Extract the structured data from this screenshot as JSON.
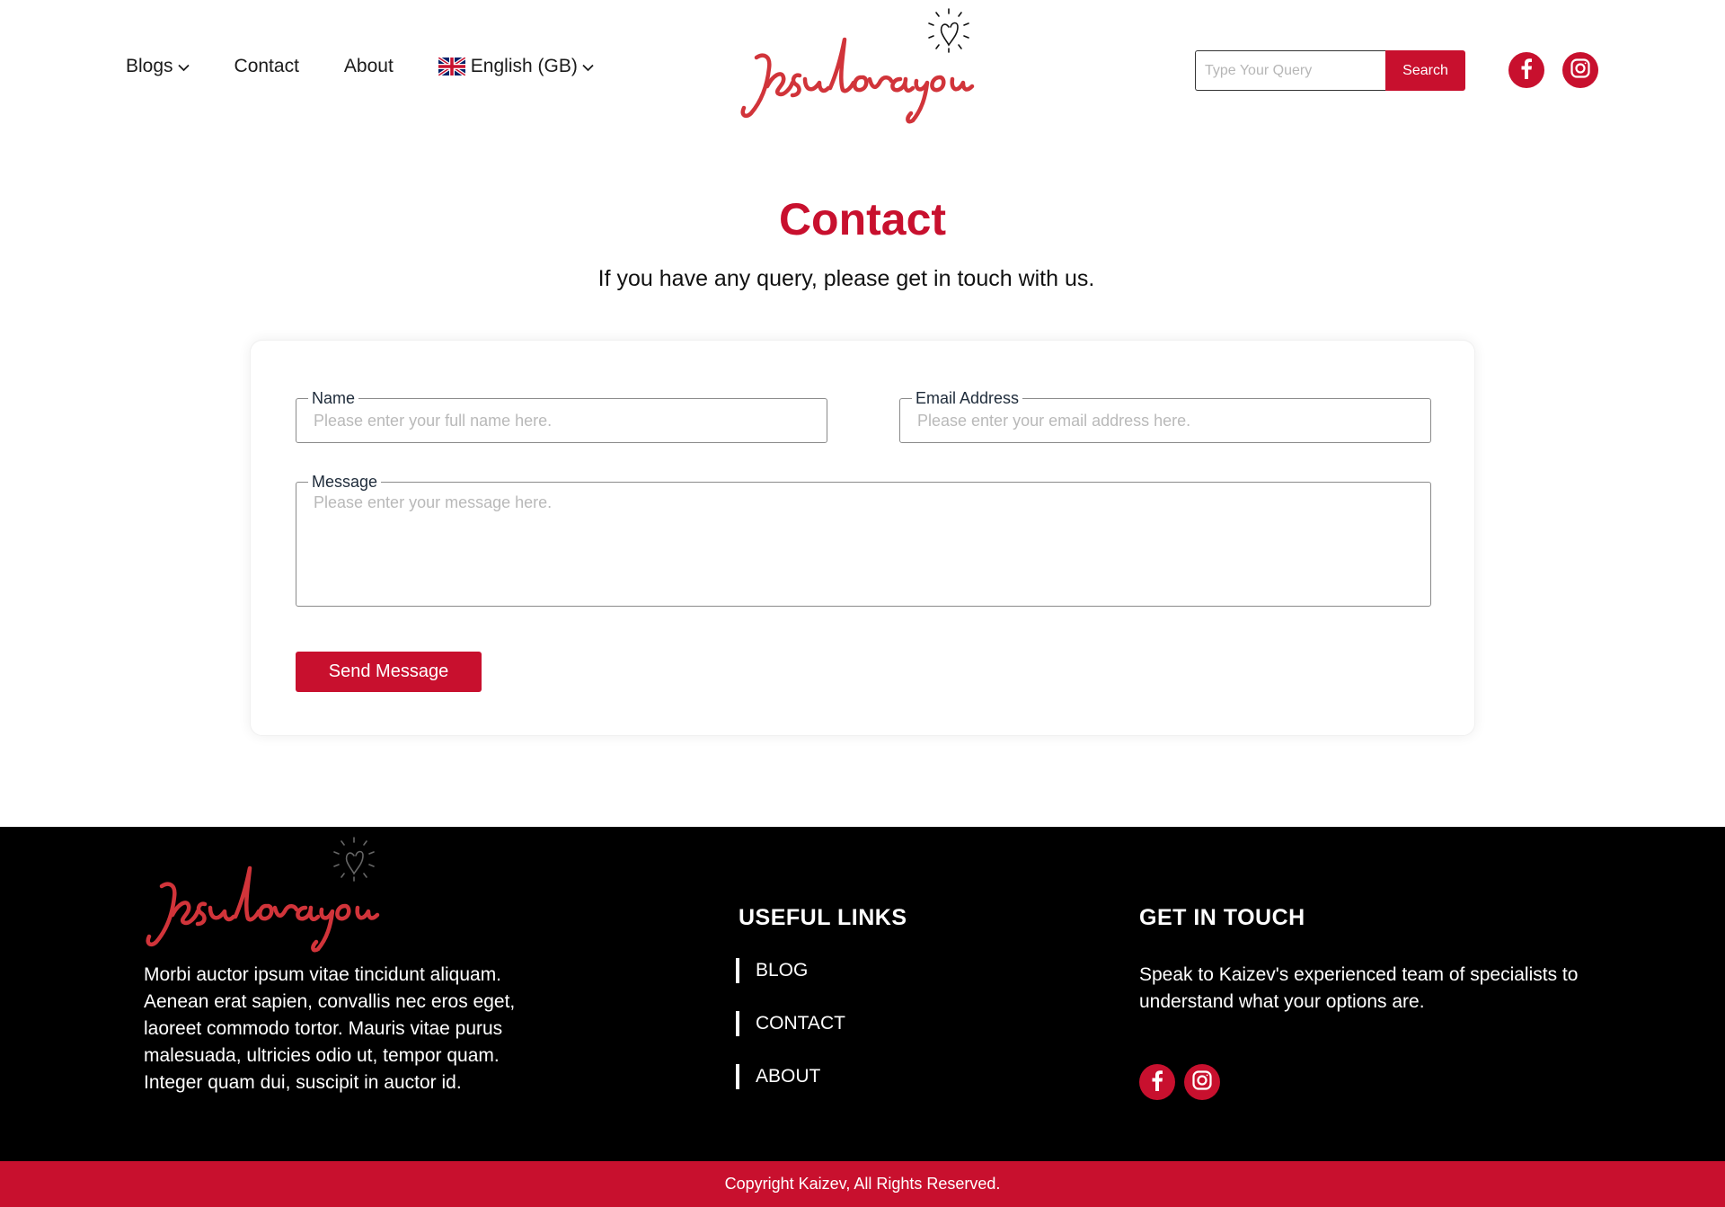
{
  "header": {
    "nav": {
      "blogs": "Blogs",
      "contact": "Contact",
      "about": "About",
      "language": "English (GB)"
    },
    "search": {
      "placeholder": "Type Your Query",
      "button": "Search"
    },
    "social": [
      "facebook-icon",
      "instagram-icon"
    ]
  },
  "main": {
    "title": "Contact",
    "subtitle": "If you have any query, please get in touch with us.",
    "form": {
      "name_label": "Name",
      "name_placeholder": "Please enter your full name here.",
      "email_label": "Email Address",
      "email_placeholder": "Please enter your email address here.",
      "message_label": "Message",
      "message_placeholder": "Please enter your message here.",
      "submit": "Send Message"
    }
  },
  "footer": {
    "about_text": "Morbi auctor ipsum vitae tincidunt aliquam. Aenean erat sapien, convallis nec eros eget, laoreet commodo tortor. Mauris vitae purus malesuada, ultricies odio ut, tempor quam. Integer quam dui, suscipit in auctor id.",
    "links_heading": "USEFUL LINKS",
    "links": [
      "BLOG",
      "CONTACT",
      "ABOUT"
    ],
    "touch_heading": "GET IN TOUCH",
    "touch_text": "Speak to Kaizev's experienced team of specialists to understand what your options are.",
    "copyright": "Copyright Kaizev, All Rights Reserved."
  },
  "colors": {
    "accent": "#c8102e",
    "footer_bg": "#000000"
  }
}
